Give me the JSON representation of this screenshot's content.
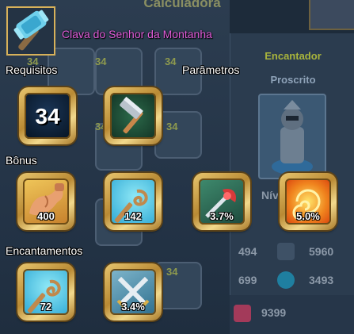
{
  "background": {
    "title": "Calculadora",
    "enchanter_title": "Encantador",
    "enchanter_subtitle": "Proscrito",
    "slot_levels": [
      "34",
      "34",
      "34",
      "34",
      "34",
      "34"
    ],
    "level_label_partial": "Nív",
    "stats": [
      {
        "left": "494",
        "right": "5960"
      },
      {
        "left": "699",
        "right": "3493"
      }
    ],
    "bottom_stat": "9399"
  },
  "tooltip": {
    "item_name": "Clava do Senhor da Montanha",
    "sections": {
      "requirements": "Requisitos",
      "parameters": "Parâmetros",
      "bonus": "Bônus",
      "enchantments": "Encantamentos"
    },
    "requirements": {
      "level_value": "34"
    },
    "bonus": [
      {
        "icon": "strength-arm-icon",
        "value": "400"
      },
      {
        "icon": "magic-staff-swirl-icon",
        "value": "142"
      },
      {
        "icon": "critical-sword-icon",
        "value": "3.7%"
      },
      {
        "icon": "fire-swirl-icon",
        "value": "5.0%"
      }
    ],
    "enchantments": [
      {
        "icon": "magic-staff-swirl-icon",
        "value": "72"
      },
      {
        "icon": "crossed-swords-icon",
        "value": "3.4%"
      }
    ]
  },
  "colors": {
    "item_name": "#e05cd9",
    "gold_frame": "#d7b15a",
    "enchanter_title": "#a8b43c",
    "enchanter_subtitle": "#8ea2b8"
  }
}
